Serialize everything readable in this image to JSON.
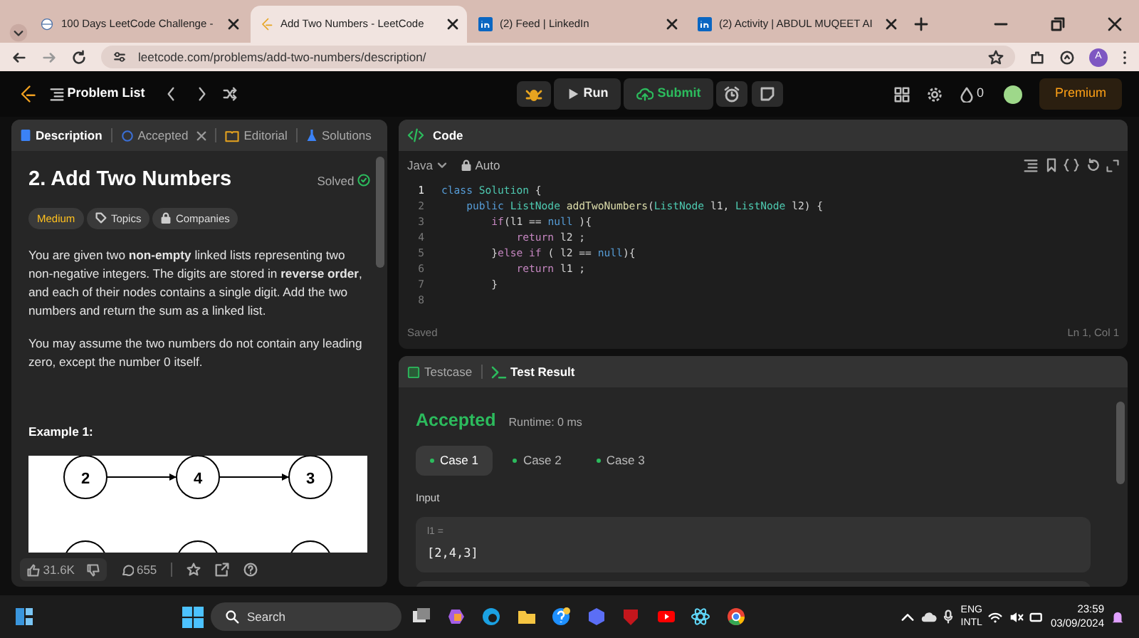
{
  "browser": {
    "tabs": [
      {
        "title": "100 Days LeetCode Challenge -",
        "selected": false
      },
      {
        "title": "Add Two Numbers - LeetCode",
        "selected": true
      },
      {
        "title": "(2) Feed | LinkedIn",
        "selected": false
      },
      {
        "title": "(2) Activity | ABDUL MUQEET AI",
        "selected": false
      }
    ],
    "address": "leetcode.com/problems/add-two-numbers/description/",
    "profile_initial": "A"
  },
  "app_bar": {
    "problem_list": "Problem List",
    "run": "Run",
    "submit": "Submit",
    "streak": "0",
    "premium": "Premium"
  },
  "left_tabs": [
    {
      "label": "Description",
      "selected": true,
      "closable": false
    },
    {
      "label": "Accepted",
      "selected": false,
      "closable": true
    },
    {
      "label": "Editorial",
      "selected": false,
      "closable": false
    },
    {
      "label": "Solutions",
      "selected": false,
      "closable": false
    }
  ],
  "problem": {
    "title": "2. Add Two Numbers",
    "status": "Solved",
    "tags": [
      {
        "label": "Medium",
        "kind": "difficulty"
      },
      {
        "label": "Topics",
        "kind": "topics"
      },
      {
        "label": "Companies",
        "kind": "companies"
      }
    ],
    "paragraphs": [
      "You are given two **non-empty** linked lists representing two non-negative integers. The digits are stored in **reverse order**, and each of their nodes contains a single digit. Add the two numbers and return the sum as a linked list.",
      "You may assume the two numbers do not contain any leading zero, except the number 0 itself."
    ],
    "example_heading": "Example 1:",
    "diagram_nodes": [
      "2",
      "4",
      "3"
    ],
    "likes": "31.6K",
    "comments": "655"
  },
  "code_panel": {
    "title": "Code",
    "language": "Java",
    "mode": "Auto",
    "lines": [
      {
        "number": "1",
        "current": true,
        "tokens": [
          {
            "text": "class ",
            "kind": "keyword"
          },
          {
            "text": "Solution",
            "kind": "type"
          },
          {
            "text": " {",
            "kind": "plain"
          }
        ]
      },
      {
        "number": "2",
        "current": false,
        "tokens": [
          {
            "text": "    public ",
            "kind": "keyword"
          },
          {
            "text": "ListNode ",
            "kind": "type"
          },
          {
            "text": "addTwoNumbers",
            "kind": "function"
          },
          {
            "text": "(",
            "kind": "plain"
          },
          {
            "text": "ListNode ",
            "kind": "type"
          },
          {
            "text": "l1, ",
            "kind": "plain"
          },
          {
            "text": "ListNode ",
            "kind": "type"
          },
          {
            "text": "l2) {",
            "kind": "plain"
          }
        ]
      },
      {
        "number": "3",
        "current": false,
        "tokens": [
          {
            "text": "        if",
            "kind": "control"
          },
          {
            "text": "(l1 == ",
            "kind": "plain"
          },
          {
            "text": "null",
            "kind": "keyword"
          },
          {
            "text": " ){",
            "kind": "plain"
          }
        ]
      },
      {
        "number": "4",
        "current": false,
        "tokens": [
          {
            "text": "            return ",
            "kind": "control"
          },
          {
            "text": "l2 ;",
            "kind": "plain"
          }
        ]
      },
      {
        "number": "5",
        "current": false,
        "tokens": [
          {
            "text": "        }",
            "kind": "plain"
          },
          {
            "text": "else if ",
            "kind": "control"
          },
          {
            "text": "( l2 == ",
            "kind": "plain"
          },
          {
            "text": "null",
            "kind": "keyword"
          },
          {
            "text": "){",
            "kind": "plain"
          }
        ]
      },
      {
        "number": "6",
        "current": false,
        "tokens": [
          {
            "text": "            return ",
            "kind": "control"
          },
          {
            "text": "l1 ;",
            "kind": "plain"
          }
        ]
      },
      {
        "number": "7",
        "current": false,
        "tokens": [
          {
            "text": "        }",
            "kind": "plain"
          }
        ]
      },
      {
        "number": "8",
        "current": false
      }
    ],
    "status": "Saved",
    "cursor": "Ln 1, Col 1"
  },
  "result_panel": {
    "tabs": [
      {
        "label": "Testcase",
        "selected": false
      },
      {
        "label": "Test Result",
        "selected": true
      }
    ],
    "verdict": "Accepted",
    "runtime": "Runtime: 0 ms",
    "cases": [
      {
        "label": "Case 1",
        "selected": true
      },
      {
        "label": "Case 2",
        "selected": false
      },
      {
        "label": "Case 3",
        "selected": false
      }
    ],
    "input_label": "Input",
    "inputs": [
      {
        "name": "l1 =",
        "value": "[2,4,3]"
      }
    ]
  },
  "taskbar": {
    "search": "Search",
    "language": [
      "ENG",
      "INTL"
    ],
    "time": "23:59",
    "date": "03/09/2024"
  }
}
